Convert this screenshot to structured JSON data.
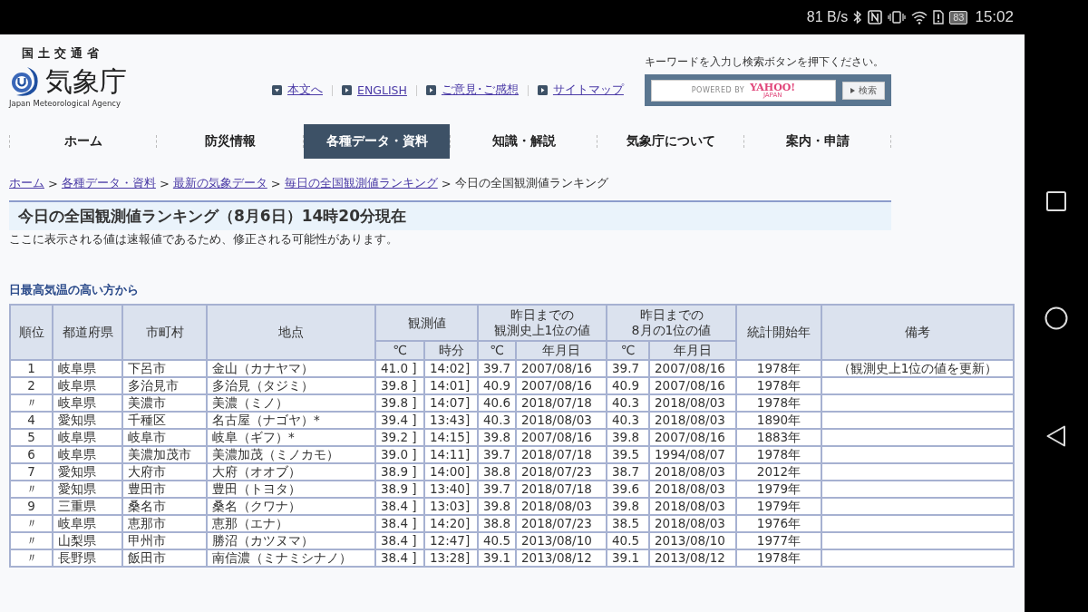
{
  "status_bar": {
    "speed": "81 B/s",
    "battery": "83",
    "time": "15:02"
  },
  "header": {
    "ministry": "国土交通省",
    "agency": "気象庁",
    "agency_en": "Japan Meteorological Agency",
    "links": [
      {
        "label": "本文へ",
        "kind": "down"
      },
      {
        "label": "ENGLISH",
        "kind": "right"
      },
      {
        "label": "ご意見･ご感想",
        "kind": "right"
      },
      {
        "label": "サイトマップ",
        "kind": "right"
      }
    ],
    "search": {
      "hint": "キーワードを入力し検索ボタンを押下ください。",
      "powered_by": "POWERED BY",
      "brand": "YAHOO!",
      "brand_sub": "JAPAN",
      "button": "検索"
    }
  },
  "nav": [
    {
      "label": "ホーム",
      "selected": false
    },
    {
      "label": "防災情報",
      "selected": false
    },
    {
      "label": "各種データ・資料",
      "selected": true
    },
    {
      "label": "知識・解説",
      "selected": false
    },
    {
      "label": "気象庁について",
      "selected": false
    },
    {
      "label": "案内・申請",
      "selected": false
    }
  ],
  "breadcrumb_separator": ">",
  "breadcrumb": [
    {
      "label": "ホーム",
      "kind": "link"
    },
    {
      "label": "各種データ・資料",
      "kind": "link"
    },
    {
      "label": "最新の気象データ",
      "kind": "link"
    },
    {
      "label": "毎日の全国観測値ランキング",
      "kind": "link"
    },
    {
      "label": "今日の全国観測値ランキング",
      "kind": "current"
    }
  ],
  "title": "今日の全国観測値ランキング（8月6日）14時20分現在",
  "notice": "ここに表示される値は速報値であるため、修正される可能性があります。",
  "section_heading": "日最高気温の高い方から",
  "table": {
    "header": {
      "rank": "順位",
      "prefecture": "都道府県",
      "city": "市町村",
      "station": "地点",
      "observed": {
        "lines": [
          "観測値"
        ],
        "sub": [
          "℃",
          "時分"
        ]
      },
      "record_all": {
        "lines": [
          "昨日までの",
          "観測史上1位の値"
        ],
        "sub": [
          "℃",
          "年月日"
        ]
      },
      "record_month": {
        "lines": [
          "昨日までの",
          "8月の1位の値"
        ],
        "sub": [
          "℃",
          "年月日"
        ]
      },
      "start_year": "統計開始年",
      "remarks": "備考"
    },
    "rows": [
      {
        "rank": "1",
        "prefecture": "岐阜県",
        "city": "下呂市",
        "station": "金山（カナヤマ）",
        "temp": "41.0 ]",
        "time": "14:02]",
        "all_c": "39.7",
        "all_date": "2007/08/16",
        "month_c": "39.7",
        "month_date": "2007/08/16",
        "start_year": "1978年",
        "remarks": "（観測史上1位の値を更新）"
      },
      {
        "rank": "2",
        "prefecture": "岐阜県",
        "city": "多治見市",
        "station": "多治見（タジミ）",
        "temp": "39.8 ]",
        "time": "14:01]",
        "all_c": "40.9",
        "all_date": "2007/08/16",
        "month_c": "40.9",
        "month_date": "2007/08/16",
        "start_year": "1978年"
      },
      {
        "rank": "〃",
        "prefecture": "岐阜県",
        "city": "美濃市",
        "station": "美濃（ミノ）",
        "temp": "39.8 ]",
        "time": "14:07]",
        "all_c": "40.6",
        "all_date": "2018/07/18",
        "month_c": "40.3",
        "month_date": "2018/08/03",
        "start_year": "1978年"
      },
      {
        "rank": "4",
        "prefecture": "愛知県",
        "city": "千種区",
        "station": "名古屋（ナゴヤ）*",
        "temp": "39.4 ]",
        "time": "13:43]",
        "all_c": "40.3",
        "all_date": "2018/08/03",
        "month_c": "40.3",
        "month_date": "2018/08/03",
        "start_year": "1890年"
      },
      {
        "rank": "5",
        "prefecture": "岐阜県",
        "city": "岐阜市",
        "station": "岐阜（ギフ）*",
        "temp": "39.2 ]",
        "time": "14:15]",
        "all_c": "39.8",
        "all_date": "2007/08/16",
        "month_c": "39.8",
        "month_date": "2007/08/16",
        "start_year": "1883年"
      },
      {
        "rank": "6",
        "prefecture": "岐阜県",
        "city": "美濃加茂市",
        "station": "美濃加茂（ミノカモ）",
        "temp": "39.0 ]",
        "time": "14:11]",
        "all_c": "39.7",
        "all_date": "2018/07/18",
        "month_c": "39.5",
        "month_date": "1994/08/07",
        "start_year": "1978年"
      },
      {
        "rank": "7",
        "prefecture": "愛知県",
        "city": "大府市",
        "station": "大府（オオブ）",
        "temp": "38.9 ]",
        "time": "14:00]",
        "all_c": "38.8",
        "all_date": "2018/07/23",
        "month_c": "38.7",
        "month_date": "2018/08/03",
        "start_year": "2012年"
      },
      {
        "rank": "〃",
        "prefecture": "愛知県",
        "city": "豊田市",
        "station": "豊田（トヨタ）",
        "temp": "38.9 ]",
        "time": "13:40]",
        "all_c": "39.7",
        "all_date": "2018/07/18",
        "month_c": "39.6",
        "month_date": "2018/08/03",
        "start_year": "1979年"
      },
      {
        "rank": "9",
        "prefecture": "三重県",
        "city": "桑名市",
        "station": "桑名（クワナ）",
        "temp": "38.4 ]",
        "time": "13:03]",
        "all_c": "39.8",
        "all_date": "2018/08/03",
        "month_c": "39.8",
        "month_date": "2018/08/03",
        "start_year": "1979年"
      },
      {
        "rank": "〃",
        "prefecture": "岐阜県",
        "city": "恵那市",
        "station": "恵那（エナ）",
        "temp": "38.4 ]",
        "time": "14:20]",
        "all_c": "38.8",
        "all_date": "2018/07/23",
        "month_c": "38.5",
        "month_date": "2018/08/03",
        "start_year": "1976年"
      },
      {
        "rank": "〃",
        "prefecture": "山梨県",
        "city": "甲州市",
        "station": "勝沼（カツヌマ）",
        "temp": "38.4 ]",
        "time": "12:47]",
        "all_c": "40.5",
        "all_date": "2013/08/10",
        "month_c": "40.5",
        "month_date": "2013/08/10",
        "start_year": "1977年"
      },
      {
        "rank": "〃",
        "prefecture": "長野県",
        "city": "飯田市",
        "station": "南信濃（ミナミシナノ）",
        "temp": "38.4 ]",
        "time": "13:28]",
        "all_c": "39.1",
        "all_date": "2013/08/12",
        "month_c": "39.1",
        "month_date": "2013/08/12",
        "start_year": "1978年"
      }
    ]
  }
}
